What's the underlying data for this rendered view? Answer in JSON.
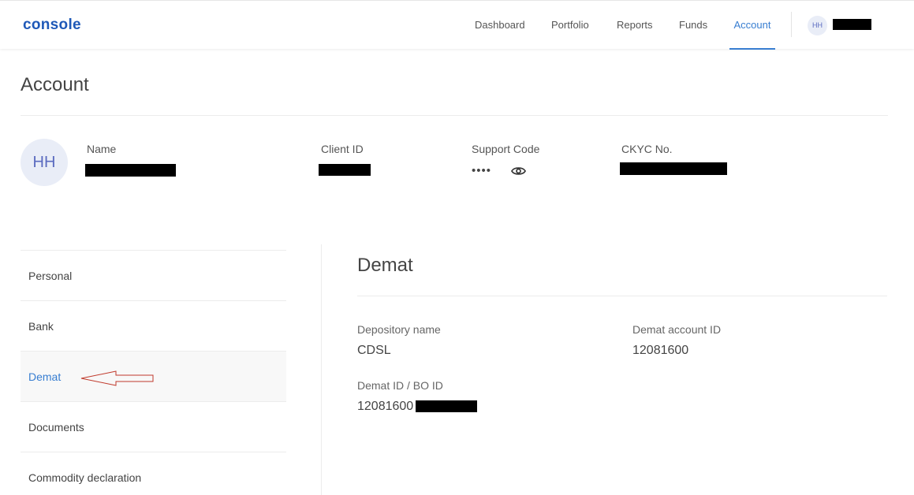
{
  "brand": {
    "logo_text": "console",
    "accent_color": "#387ed1"
  },
  "nav": {
    "items": [
      {
        "label": "Dashboard",
        "active": false
      },
      {
        "label": "Portfolio",
        "active": false
      },
      {
        "label": "Reports",
        "active": false
      },
      {
        "label": "Funds",
        "active": false
      },
      {
        "label": "Account",
        "active": true
      }
    ],
    "user_initials": "HH"
  },
  "page": {
    "title": "Account"
  },
  "profile": {
    "avatar_initials": "HH",
    "name_label": "Name",
    "client_id_label": "Client ID",
    "support_code_label": "Support Code",
    "support_code_masked": "••••",
    "ckyc_label": "CKYC No."
  },
  "sidebar": {
    "items": [
      {
        "label": "Personal",
        "active": false
      },
      {
        "label": "Bank",
        "active": false
      },
      {
        "label": "Demat",
        "active": true
      },
      {
        "label": "Documents",
        "active": false
      },
      {
        "label": "Commodity declaration",
        "active": false
      }
    ]
  },
  "demat": {
    "title": "Demat",
    "depository_label": "Depository name",
    "depository_value": "CDSL",
    "account_id_label": "Demat account ID",
    "account_id_value": "12081600",
    "bo_id_label": "Demat ID / BO ID",
    "bo_id_value": "12081600"
  }
}
